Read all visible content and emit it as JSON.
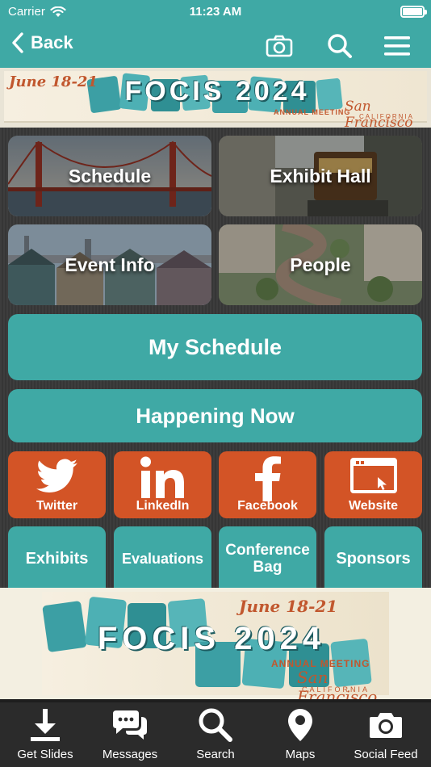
{
  "status_bar": {
    "carrier": "Carrier",
    "time": "11:23 AM"
  },
  "nav": {
    "back_label": "Back"
  },
  "banner_top": {
    "dates": "June 18-21",
    "event": "FOCIS 2024",
    "subtitle": "ANNUAL MEETING",
    "city": "San Francisco",
    "state": "CALIFORNIA"
  },
  "tiles": [
    {
      "label": "Schedule"
    },
    {
      "label": "Exhibit Hall"
    },
    {
      "label": "Event Info"
    },
    {
      "label": "People"
    }
  ],
  "buttons": {
    "my_schedule": "My Schedule",
    "happening_now": "Happening Now"
  },
  "social": [
    {
      "label": "Twitter",
      "icon": "twitter-bird-icon"
    },
    {
      "label": "LinkedIn",
      "icon": "linkedin-icon"
    },
    {
      "label": "Facebook",
      "icon": "facebook-icon"
    },
    {
      "label": "Website",
      "icon": "browser-window-icon"
    }
  ],
  "small_buttons": [
    {
      "label": "Exhibits"
    },
    {
      "label": "Evaluations"
    },
    {
      "label": "Conference Bag"
    },
    {
      "label": "Sponsors"
    }
  ],
  "banner_bottom": {
    "dates": "June 18-21",
    "event": "FOCIS 2024",
    "subtitle": "ANNUAL MEETING",
    "city": "San Francisco",
    "state": "CALIFORNIA"
  },
  "tabbar": [
    {
      "label": "Get Slides",
      "icon": "download-icon"
    },
    {
      "label": "Messages",
      "icon": "chat-bubbles-icon"
    },
    {
      "label": "Search",
      "icon": "search-icon"
    },
    {
      "label": "Maps",
      "icon": "map-pin-icon"
    },
    {
      "label": "Social Feed",
      "icon": "camera-icon"
    }
  ],
  "colors": {
    "teal": "#3fa9a5",
    "orange": "#d35426",
    "dark": "#2b2b2b"
  }
}
